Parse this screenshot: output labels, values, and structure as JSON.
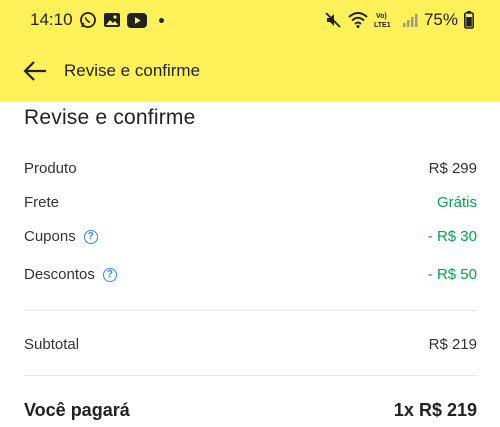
{
  "status_bar": {
    "time": "14:10",
    "battery": "75%",
    "network_label": "Vo) LTE1"
  },
  "app_bar": {
    "title": "Revise e confirme",
    "icon": "back-arrow-icon"
  },
  "summary": {
    "title": "Revise e confirme",
    "rows": [
      {
        "label": "Produto",
        "value": "R$ 299"
      },
      {
        "label": "Frete",
        "value": "Grátis"
      },
      {
        "label": "Cupons",
        "value": "- R$ 30"
      },
      {
        "label": "Descontos",
        "value": "- R$ 50"
      }
    ],
    "subtotal": {
      "label": "Subtotal",
      "value": "R$ 219"
    },
    "total": {
      "label": "Você pagará",
      "value": "1x R$ 219"
    }
  },
  "colors": {
    "brand_yellow": "#fff159",
    "green": "#00a650",
    "link_blue": "#3483fa"
  }
}
